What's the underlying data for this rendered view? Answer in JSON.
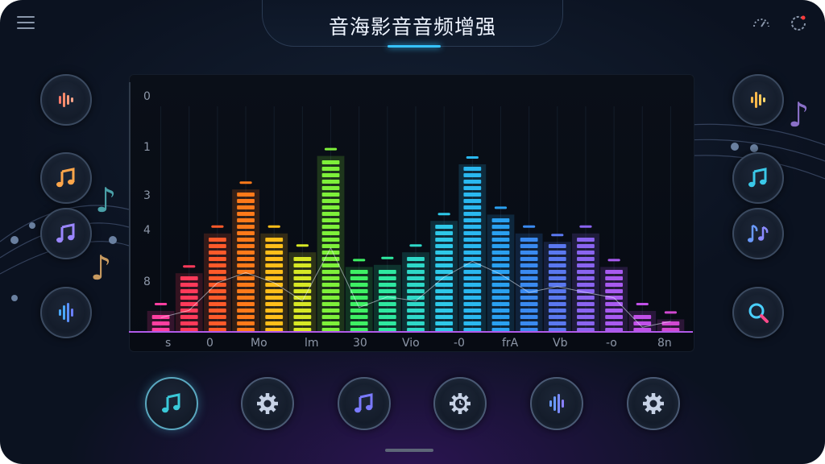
{
  "header": {
    "title": "音海影音音频增强"
  },
  "icons": {
    "menu": "menu-icon",
    "speed": "speedometer-icon",
    "refresh": "refresh-icon"
  },
  "chart_data": {
    "type": "bar",
    "y_tick_labels": [
      "0",
      "1",
      "3",
      "4",
      "8"
    ],
    "x_tick_labels": [
      "s",
      "0",
      "Mo",
      "lm",
      "30",
      "Vio",
      "-0",
      "frA",
      "Vb",
      "-o",
      "8n"
    ],
    "values": [
      0.1,
      0.28,
      0.47,
      0.68,
      0.47,
      0.38,
      0.84,
      0.31,
      0.32,
      0.38,
      0.53,
      0.8,
      0.56,
      0.47,
      0.43,
      0.47,
      0.31,
      0.1,
      0.06
    ],
    "colors": [
      "#ff3fa0",
      "#ff3a5a",
      "#ff5a2a",
      "#ff7a1a",
      "#ffbe1a",
      "#d7e825",
      "#7ef03a",
      "#3ef064",
      "#2ee8a0",
      "#2ed8c8",
      "#2ec8e8",
      "#2ab8f0",
      "#2aa0f0",
      "#3a8af0",
      "#5a78f0",
      "#8a64f0",
      "#a85af0",
      "#c050e8",
      "#d048d0"
    ],
    "ylim": [
      0,
      1
    ],
    "legend": "none",
    "grid": true
  },
  "left_buttons": [
    {
      "name": "equalizer-icon",
      "color": "#ff7a6a"
    },
    {
      "name": "music-note-icon",
      "color": "#ffa64a"
    },
    {
      "name": "music-note-icon",
      "color": "#9a86ff"
    },
    {
      "name": "waveform-icon",
      "color": "#4aa8ff"
    }
  ],
  "right_buttons": [
    {
      "name": "equalizer-icon",
      "color": "#ffb84a"
    },
    {
      "name": "music-note-icon",
      "color": "#3ac8e8"
    },
    {
      "name": "double-note-icon",
      "color": "#6a9aff"
    },
    {
      "name": "search-icon",
      "color": "#4ad0ff"
    }
  ],
  "bottom_buttons": [
    {
      "name": "music-note-icon",
      "color": "#3ac8d8"
    },
    {
      "name": "gear-icon",
      "color": "#c7d2e6"
    },
    {
      "name": "music-note-icon",
      "color": "#7a7aff"
    },
    {
      "name": "clock-gear-icon",
      "color": "#c7d2e6"
    },
    {
      "name": "waveform-icon",
      "color": "#6a9aff"
    },
    {
      "name": "gear-icon",
      "color": "#c7d2e6"
    }
  ]
}
